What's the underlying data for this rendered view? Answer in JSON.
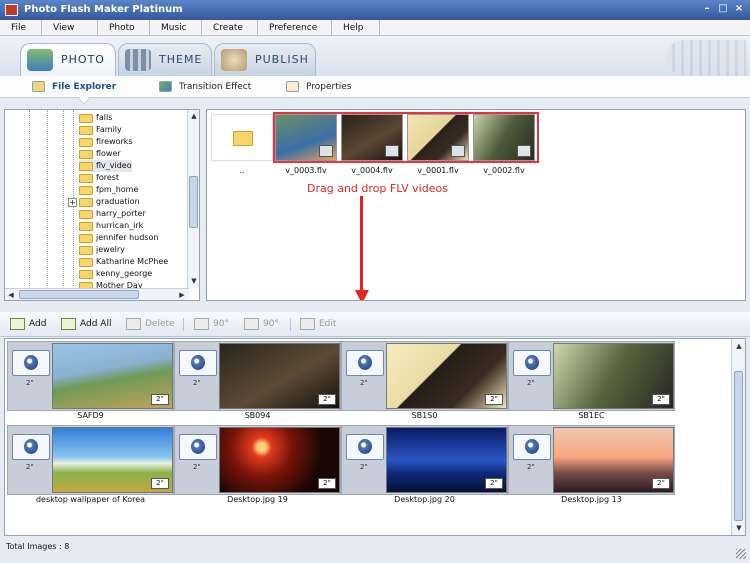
{
  "window": {
    "title": "Photo Flash Maker Platinum",
    "minimize_glyph": "–",
    "maximize_glyph": "□",
    "close_glyph": "×"
  },
  "menu": [
    "File",
    "View",
    "Photo",
    "Music",
    "Create",
    "Preference",
    "Help"
  ],
  "main_tabs": [
    {
      "label": "PHOTO",
      "icon": "photo-icon",
      "active": true
    },
    {
      "label": "THEME",
      "icon": "theme-icon",
      "active": false
    },
    {
      "label": "PUBLISH",
      "icon": "publish-icon",
      "active": false
    }
  ],
  "sub_tabs": [
    {
      "label": "File Explorer",
      "icon": "file-explorer-icon",
      "active": true
    },
    {
      "label": "Transition Effect",
      "icon": "transition-effect-icon",
      "active": false
    },
    {
      "label": "Properties",
      "icon": "properties-icon",
      "active": false
    }
  ],
  "folder_tree": {
    "items": [
      "falls",
      "Family",
      "fireworks",
      "flower",
      "flv_video",
      "forest",
      "fpm_home",
      "graduation",
      "harry_porter",
      "hurrican_irk",
      "jennifer hudson",
      "jewelry",
      "Katharine McPhee",
      "kenny_george",
      "Mother Day"
    ],
    "selected": "flv_video",
    "expander_glyph": "+"
  },
  "files": {
    "parent_label": "..",
    "items": [
      "v_0003.flv",
      "v_0004.flv",
      "v_0001.flv",
      "v_0002.flv"
    ]
  },
  "annotation": "Drag and drop FLV videos",
  "toolbar": {
    "add": "Add",
    "add_all": "Add All",
    "delete": "Delete",
    "rotate_left": "90°",
    "rotate_right": "90°",
    "edit": "Edit"
  },
  "storyboard": {
    "transition_duration": "2\"",
    "items": [
      {
        "caption": "SAFD9",
        "duration": "2\""
      },
      {
        "caption": "SB094",
        "duration": "2\""
      },
      {
        "caption": "SB1S0",
        "duration": "2\""
      },
      {
        "caption": "SB1EC",
        "duration": "2\""
      },
      {
        "caption": "desktop wallpaper of Korea",
        "duration": "2\""
      },
      {
        "caption": "Desktop.jpg 19",
        "duration": "2\""
      },
      {
        "caption": "Desktop.jpg 20",
        "duration": "2\""
      },
      {
        "caption": "Desktop.jpg 13",
        "duration": "2\""
      }
    ]
  },
  "status": {
    "total_images": "Total Images : 8"
  },
  "colors": {
    "highlight_red": "#e53244",
    "annotation_red": "#e52222",
    "title_blue": "#33599b"
  }
}
